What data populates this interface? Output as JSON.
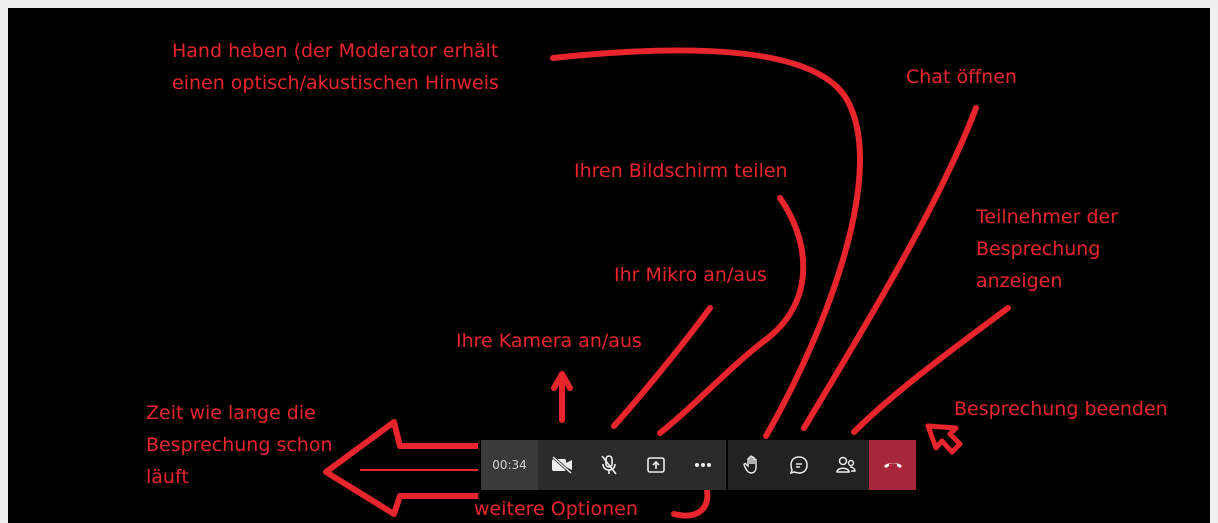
{
  "annotations": {
    "raise_hand": "Hand heben (der Moderator erhält",
    "raise_hand_2": "einen optisch/akustischen Hinweis",
    "chat": "Chat öffnen",
    "share_screen": "Ihren Bildschirm teilen",
    "participants_1": "Teilnehmer der",
    "participants_2": "Besprechung",
    "participants_3": "anzeigen",
    "mic": "Ihr Mikro an/aus",
    "camera": "Ihre Kamera an/aus",
    "timer_1": "Zeit wie lange die",
    "timer_2": "Besprechung schon",
    "timer_3": "läuft",
    "end_meeting": "Besprechung beenden",
    "more_options": "weitere Optionen"
  },
  "toolbar": {
    "elapsed_time": "00:34",
    "buttons": [
      {
        "name": "camera-off",
        "icon": "video-off-icon"
      },
      {
        "name": "mic-off",
        "icon": "mic-off-icon"
      },
      {
        "name": "share",
        "icon": "share-screen-icon"
      },
      {
        "name": "more",
        "icon": "more-icon"
      },
      {
        "name": "raise-hand",
        "icon": "hand-icon"
      },
      {
        "name": "chat",
        "icon": "chat-icon"
      },
      {
        "name": "participants",
        "icon": "people-icon"
      },
      {
        "name": "hang-up",
        "icon": "phone-hangup-icon"
      }
    ]
  },
  "colors": {
    "annotation": "#e8252d",
    "background": "#000000",
    "toolbar": "#2b2b2b",
    "hangup": "#a8263a"
  }
}
